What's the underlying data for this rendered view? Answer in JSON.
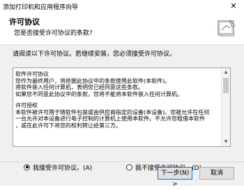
{
  "window": {
    "title": "添加打印机和应用程序向导",
    "close_glyph": "✕"
  },
  "header": {
    "title": "许可协议",
    "subtitle": "您是否接受许可协议的条款?",
    "icon": "installer-document-icon"
  },
  "intro_text": "请阅读以下许可协议。若继续安装，您必须接受许可协议。",
  "license_lines": [
    "软件许可协议",
    "您作为最终用户，将依据此协议中的条款使用此软件(本软件)。",
    "将软件装入任何计算机，表明您已经同意这些条款。",
    "如果您不同意此协议中的条款，您将不能将本软件装入任何计算机。",
    "",
    "许可授权",
    "本软件被许可用于随软件包装或由供应商指定的设备(本设备)。您被允许在任何",
    "一台允许对本设备进行电子控制的计算机上使用本软件。不允许您租借本软件",
    "，或在此许可下将您的权利转让给第三方。"
  ],
  "options": {
    "accept": {
      "label": "我接受许可协议。(A)",
      "selected": true
    },
    "decline": {
      "label": "我不接受许可协议。(D)",
      "selected": false
    }
  },
  "buttons": {
    "next": "下一步(N) >",
    "cancel": "取消"
  },
  "colors": {
    "focus_border": "#0078d7",
    "panel": "#f0f0f0"
  }
}
